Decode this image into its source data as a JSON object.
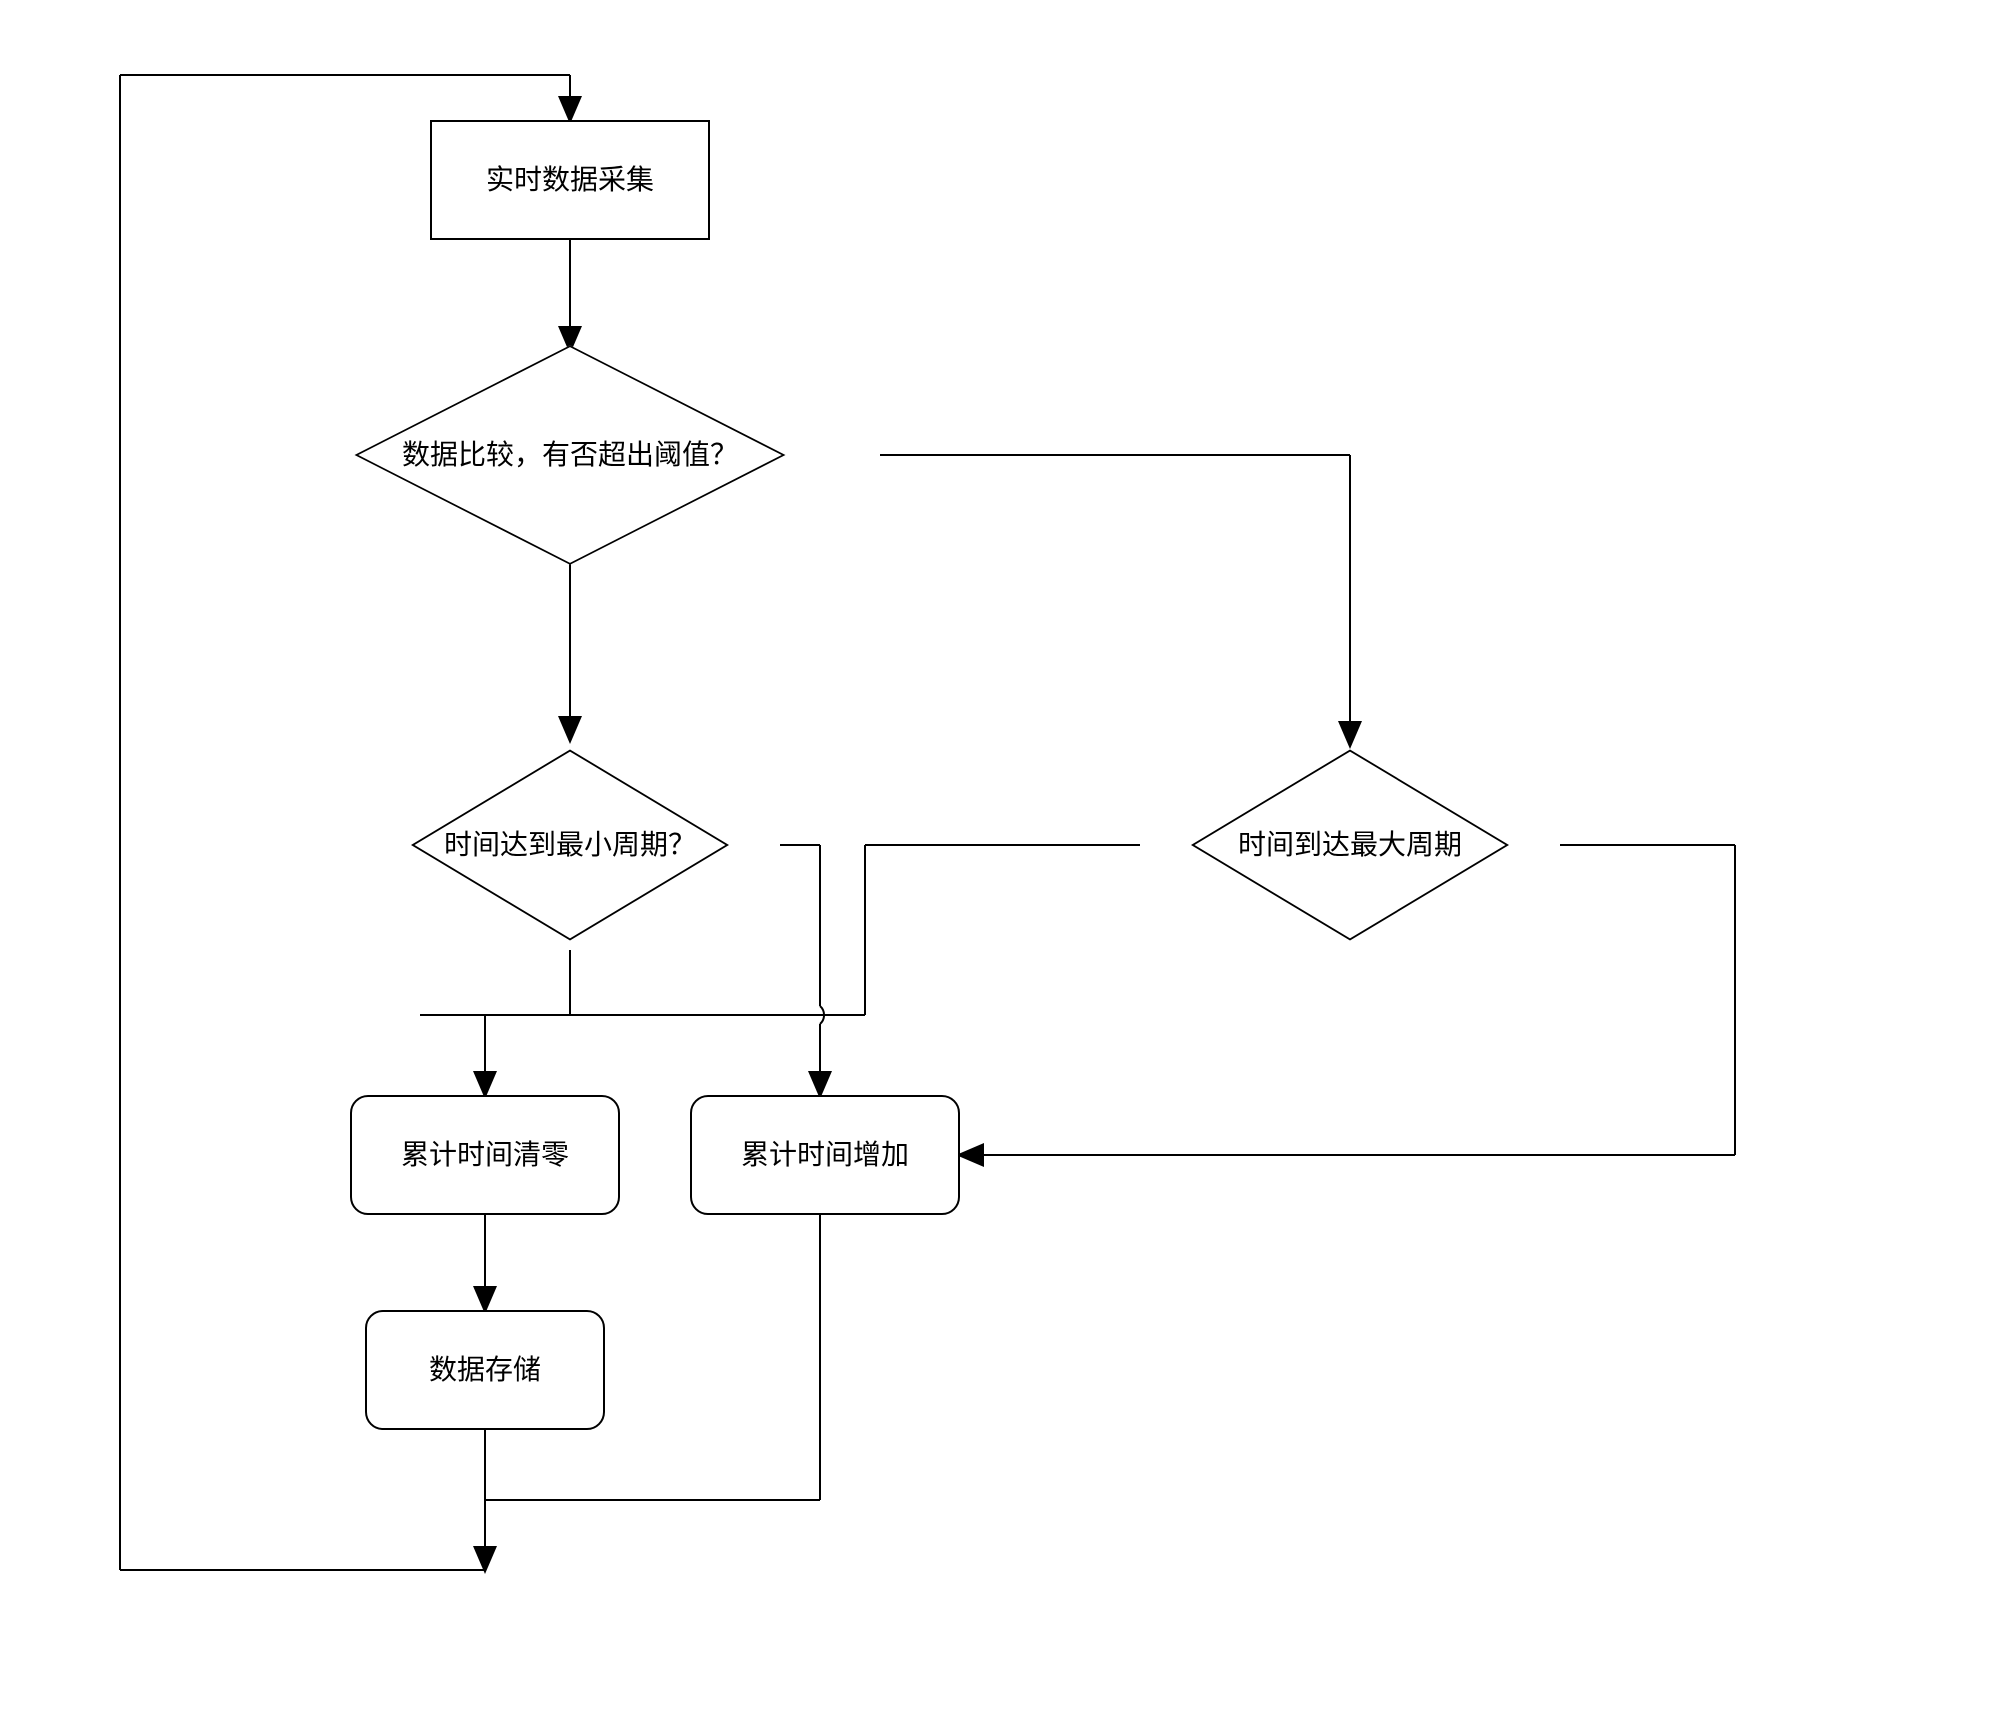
{
  "chart_data": {
    "type": "flowchart",
    "nodes": [
      {
        "id": "n1",
        "kind": "process",
        "label": "实时数据采集"
      },
      {
        "id": "n2",
        "kind": "decision",
        "label": "数据比较，有否超出阈值？"
      },
      {
        "id": "n3",
        "kind": "decision",
        "label": "时间达到最小周期？"
      },
      {
        "id": "n4",
        "kind": "decision",
        "label": "时间到达最大周期"
      },
      {
        "id": "n5",
        "kind": "process",
        "label": "累计时间清零"
      },
      {
        "id": "n6",
        "kind": "process",
        "label": "累计时间增加"
      },
      {
        "id": "n7",
        "kind": "process",
        "label": "数据存储"
      }
    ],
    "edges": [
      {
        "from": "start_loop",
        "to": "n1"
      },
      {
        "from": "n1",
        "to": "n2"
      },
      {
        "from": "n2",
        "to": "n3"
      },
      {
        "from": "n2",
        "to": "n4"
      },
      {
        "from": "n3",
        "to": "n5"
      },
      {
        "from": "n3",
        "to": "n6"
      },
      {
        "from": "n4",
        "to": "n5_path"
      },
      {
        "from": "n4",
        "to": "n6"
      },
      {
        "from": "n5",
        "to": "n7"
      },
      {
        "from": "n6",
        "to": "loop_back"
      },
      {
        "from": "n7",
        "to": "loop_back"
      }
    ]
  },
  "nodes": {
    "n1": {
      "label": "实时数据采集"
    },
    "n2": {
      "label": "数据比较，有否超出阈值？"
    },
    "n3": {
      "label": "时间达到最小周期？"
    },
    "n4": {
      "label": "时间到达最大周期"
    },
    "n5": {
      "label": "累计时间清零"
    },
    "n6": {
      "label": "累计时间增加"
    },
    "n7": {
      "label": "数据存储"
    }
  }
}
